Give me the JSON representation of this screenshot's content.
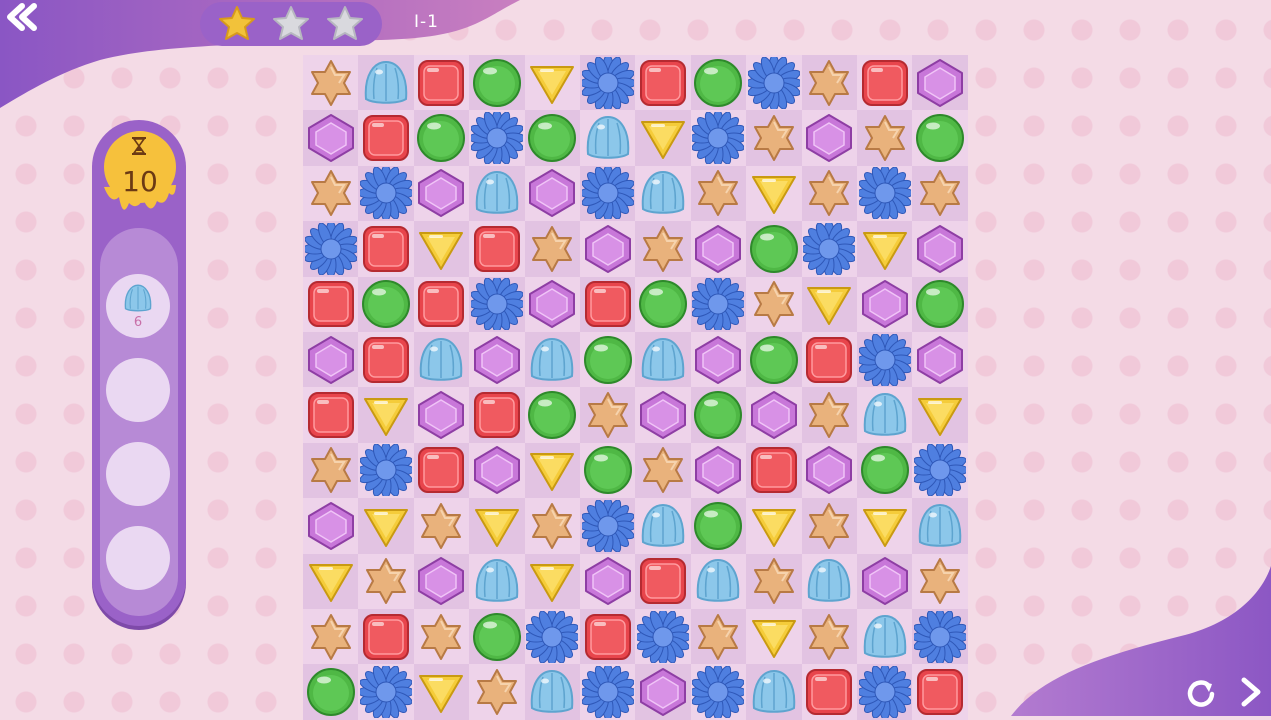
{
  "header": {
    "back_icon": "back-chevron-icon",
    "stars": [
      {
        "name": "star-1",
        "filled": true
      },
      {
        "name": "star-2",
        "filled": false
      },
      {
        "name": "star-3",
        "filled": false
      }
    ],
    "level_label": "I-1"
  },
  "goals": {
    "moves_left": "10",
    "timer_icon": "hourglass-icon",
    "targets": [
      {
        "candy": "jelly",
        "count": "6"
      }
    ],
    "empty_slots": 3
  },
  "colors": {
    "purple": "#9a62c8",
    "background": "#f4dbe6",
    "timer_yellow": "#f6c13c",
    "star_gold": "#f2c23a"
  },
  "board": {
    "legend": {
      "S": "star",
      "J": "jelly",
      "R": "red-square",
      "G": "green-circle",
      "Y": "yellow-triangle",
      "F": "blue-flower",
      "P": "purple-diamond"
    },
    "rows": [
      [
        "S",
        "J",
        "R",
        "G",
        "Y",
        "F",
        "R",
        "G",
        "F",
        "S",
        "R",
        "P"
      ],
      [
        "P",
        "R",
        "G",
        "F",
        "G",
        "J",
        "Y",
        "F",
        "S",
        "P",
        "S",
        "G"
      ],
      [
        "S",
        "F",
        "P",
        "J",
        "P",
        "F",
        "J",
        "S",
        "Y",
        "S",
        "F",
        "S"
      ],
      [
        "F",
        "R",
        "Y",
        "R",
        "S",
        "P",
        "S",
        "P",
        "G",
        "F",
        "Y",
        "P"
      ],
      [
        "R",
        "G",
        "R",
        "F",
        "P",
        "R",
        "G",
        "F",
        "S",
        "Y",
        "P",
        "G"
      ],
      [
        "P",
        "R",
        "J",
        "P",
        "J",
        "G",
        "J",
        "P",
        "G",
        "R",
        "F",
        "P"
      ],
      [
        "R",
        "Y",
        "P",
        "R",
        "G",
        "S",
        "P",
        "G",
        "P",
        "S",
        "J",
        "Y"
      ],
      [
        "S",
        "F",
        "R",
        "P",
        "Y",
        "G",
        "S",
        "P",
        "R",
        "P",
        "G",
        "F"
      ],
      [
        "P",
        "Y",
        "S",
        "Y",
        "S",
        "F",
        "J",
        "G",
        "Y",
        "S",
        "Y",
        "J"
      ],
      [
        "Y",
        "S",
        "P",
        "J",
        "Y",
        "P",
        "R",
        "J",
        "S",
        "J",
        "P",
        "S"
      ],
      [
        "S",
        "R",
        "S",
        "G",
        "F",
        "R",
        "F",
        "S",
        "Y",
        "S",
        "J",
        "F"
      ],
      [
        "G",
        "F",
        "Y",
        "S",
        "J",
        "F",
        "P",
        "F",
        "J",
        "R",
        "F",
        "R"
      ]
    ]
  },
  "footer": {
    "restart_icon": "restart-icon",
    "next_icon": "next-chevron-icon"
  }
}
